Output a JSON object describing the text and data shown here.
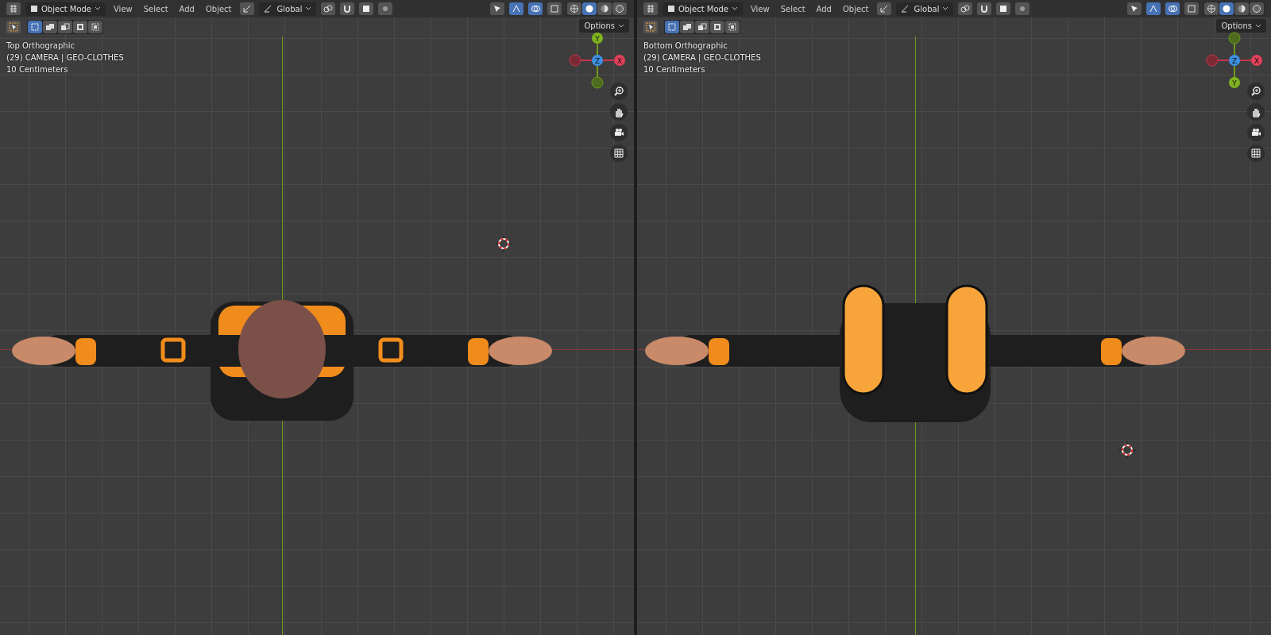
{
  "viewports": [
    {
      "kind": "top",
      "header": {
        "mode": "Object Mode",
        "menus": [
          "View",
          "Select",
          "Add",
          "Object"
        ],
        "orientation": "Global"
      },
      "options_label": "Options",
      "overlay": {
        "view_name": "Top Orthographic",
        "object_info": "(29) CAMERA | GEO-CLOTHES",
        "scale": "10 Centimeters"
      },
      "gizmo": {
        "y_label": "Y",
        "z_label": "Z",
        "x_label": "X"
      }
    },
    {
      "kind": "bottom",
      "header": {
        "mode": "Object Mode",
        "menus": [
          "View",
          "Select",
          "Add",
          "Object"
        ],
        "orientation": "Global"
      },
      "options_label": "Options",
      "overlay": {
        "view_name": "Bottom Orthographic",
        "object_info": "(29) CAMERA | GEO-CLOTHES",
        "scale": "10 Centimeters"
      },
      "gizmo": {
        "y_label": "Y",
        "z_label": "Z",
        "x_label": "X"
      }
    }
  ]
}
